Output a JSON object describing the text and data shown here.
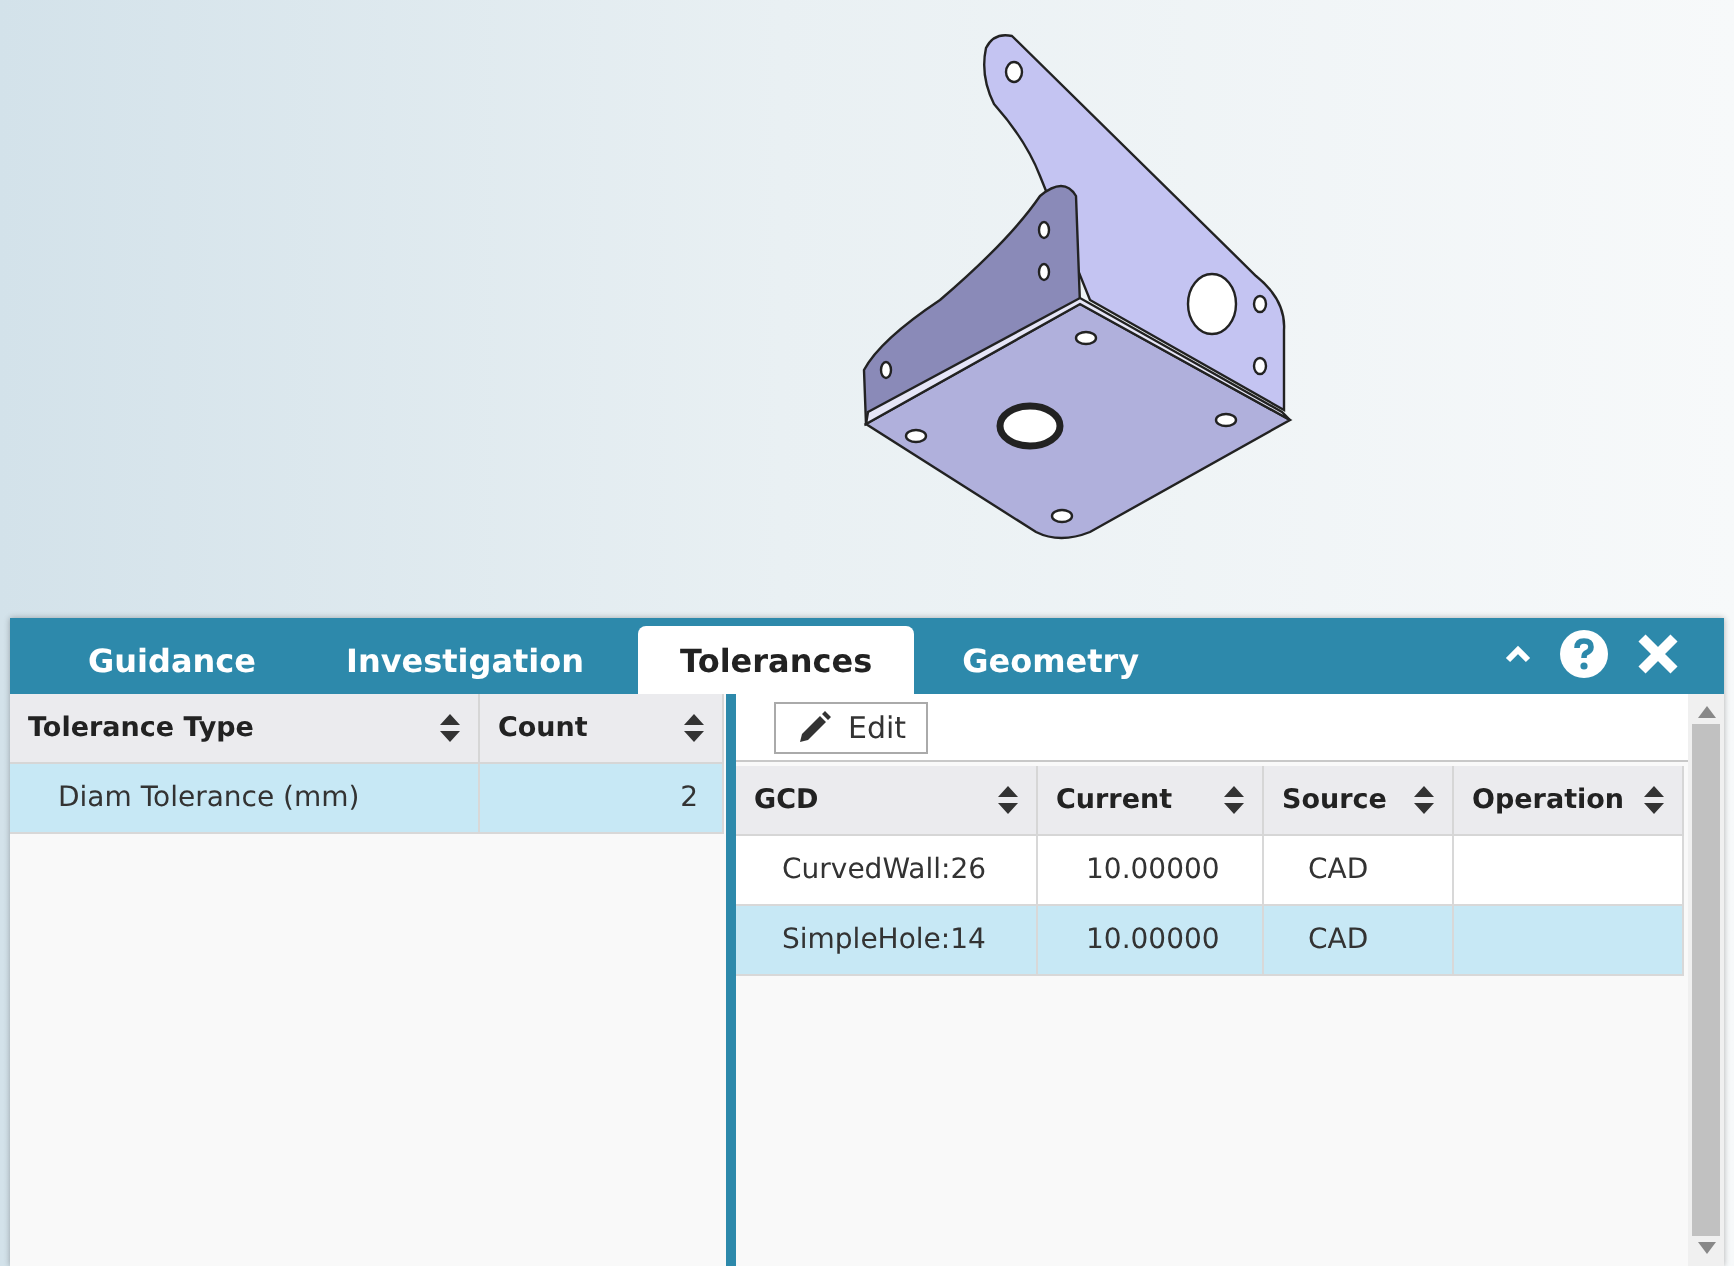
{
  "tabs": [
    {
      "label": "Guidance",
      "selected": false
    },
    {
      "label": "Investigation",
      "selected": false
    },
    {
      "label": "Tolerances",
      "selected": true
    },
    {
      "label": "Geometry",
      "selected": false
    }
  ],
  "left_table": {
    "columns": [
      "Tolerance Type",
      "Count"
    ],
    "rows": [
      {
        "cells": [
          "Diam Tolerance (mm)",
          "2"
        ],
        "selected": true
      }
    ]
  },
  "toolbar": {
    "edit_button": "Edit"
  },
  "right_table": {
    "columns": [
      "GCD",
      "Current",
      "Source",
      "Operation"
    ],
    "rows": [
      {
        "cells": [
          "CurvedWall:26",
          "10.00000",
          "CAD"
        ],
        "selected": false
      },
      {
        "cells": [
          "SimpleHole:14",
          "10.00000",
          "CAD"
        ],
        "selected": true
      }
    ]
  }
}
